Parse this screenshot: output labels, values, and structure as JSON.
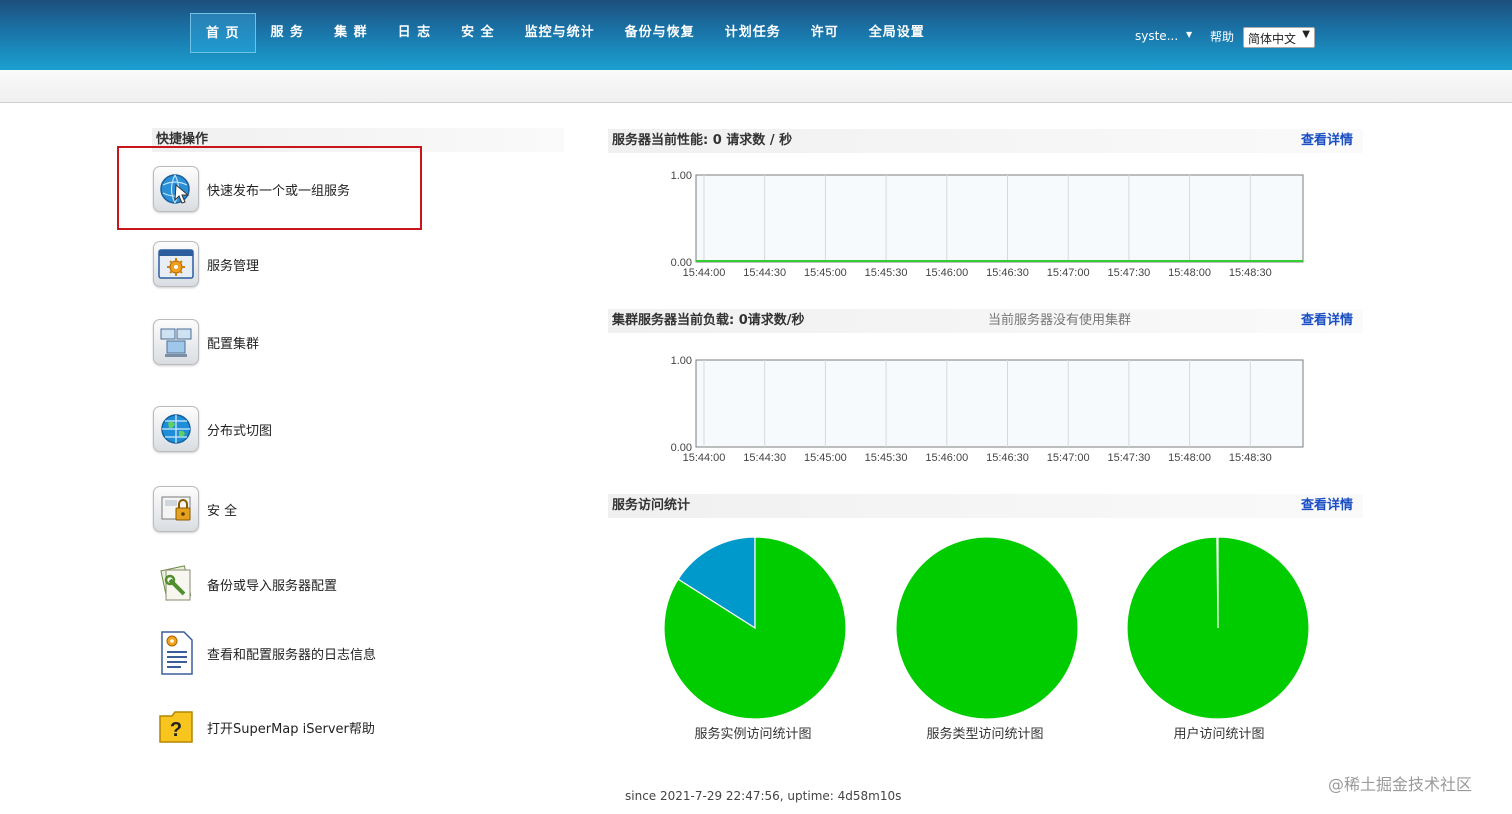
{
  "nav": {
    "items": [
      {
        "label": "首 页",
        "active": true
      },
      {
        "label": "服 务"
      },
      {
        "label": "集 群"
      },
      {
        "label": "日 志"
      },
      {
        "label": "安 全"
      },
      {
        "label": "监控与统计"
      },
      {
        "label": "备份与恢复"
      },
      {
        "label": "计划任务"
      },
      {
        "label": "许可"
      },
      {
        "label": "全局设置"
      }
    ],
    "user": "syste...",
    "help": "帮助",
    "language": "简体中文"
  },
  "quick": {
    "title": "快捷操作",
    "items": [
      {
        "label": "快速发布一个或一组服务",
        "icon": "globe-publish-icon"
      },
      {
        "label": "服务管理",
        "icon": "service-gear-icon"
      },
      {
        "label": "配置集群",
        "icon": "cluster-computers-icon"
      },
      {
        "label": "分布式切图",
        "icon": "globe-tiles-icon"
      },
      {
        "label": "安 全",
        "icon": "lock-security-icon"
      },
      {
        "label": "备份或导入服务器配置",
        "icon": "backup-tools-icon"
      },
      {
        "label": "查看和配置服务器的日志信息",
        "icon": "log-document-icon"
      },
      {
        "label": "打开SuperMap iServer帮助",
        "icon": "help-question-icon"
      }
    ]
  },
  "perf": {
    "title": "服务器当前性能: 0 请求数 / 秒",
    "link": "查看详情"
  },
  "cluster": {
    "title": "集群服务器当前负载: 0请求数/秒",
    "note": "当前服务器没有使用集群",
    "link": "查看详情"
  },
  "stats": {
    "title": "服务访问统计",
    "link": "查看详情",
    "pies": [
      {
        "label": "服务实例访问统计图"
      },
      {
        "label": "服务类型访问统计图"
      },
      {
        "label": "用户访问统计图"
      }
    ]
  },
  "chart_data": [
    {
      "type": "line",
      "x": [
        "15:44:00",
        "15:44:30",
        "15:45:00",
        "15:45:30",
        "15:46:00",
        "15:46:30",
        "15:47:00",
        "15:47:30",
        "15:48:00",
        "15:48:30"
      ],
      "series": [
        {
          "values": [
            0,
            0,
            0,
            0,
            0,
            0,
            0,
            0,
            0,
            0,
            0
          ],
          "color": "#33cc33"
        }
      ],
      "yticks": [
        "1.00",
        "0.00"
      ],
      "ylim": [
        0,
        1
      ]
    },
    {
      "type": "line",
      "x": [
        "15:44:00",
        "15:44:30",
        "15:45:00",
        "15:45:30",
        "15:46:00",
        "15:46:30",
        "15:47:00",
        "15:47:30",
        "15:48:00",
        "15:48:30"
      ],
      "series": [],
      "yticks": [
        "1.00",
        "0.00"
      ],
      "ylim": [
        0,
        1
      ]
    },
    {
      "type": "pie",
      "title": "服务实例访问统计图",
      "values": [
        0.84,
        0.16
      ],
      "colors": [
        "#00cc00",
        "#0099cc"
      ]
    },
    {
      "type": "pie",
      "title": "服务类型访问统计图",
      "values": [
        1.0
      ],
      "colors": [
        "#00cc00"
      ]
    },
    {
      "type": "pie",
      "title": "用户访问统计图",
      "values": [
        0.998,
        0.002
      ],
      "colors": [
        "#00cc00",
        "#0099cc"
      ]
    }
  ],
  "footer": "since 2021-7-29 22:47:56, uptime: 4d58m10s",
  "watermark": "@稀土掘金技术社区"
}
